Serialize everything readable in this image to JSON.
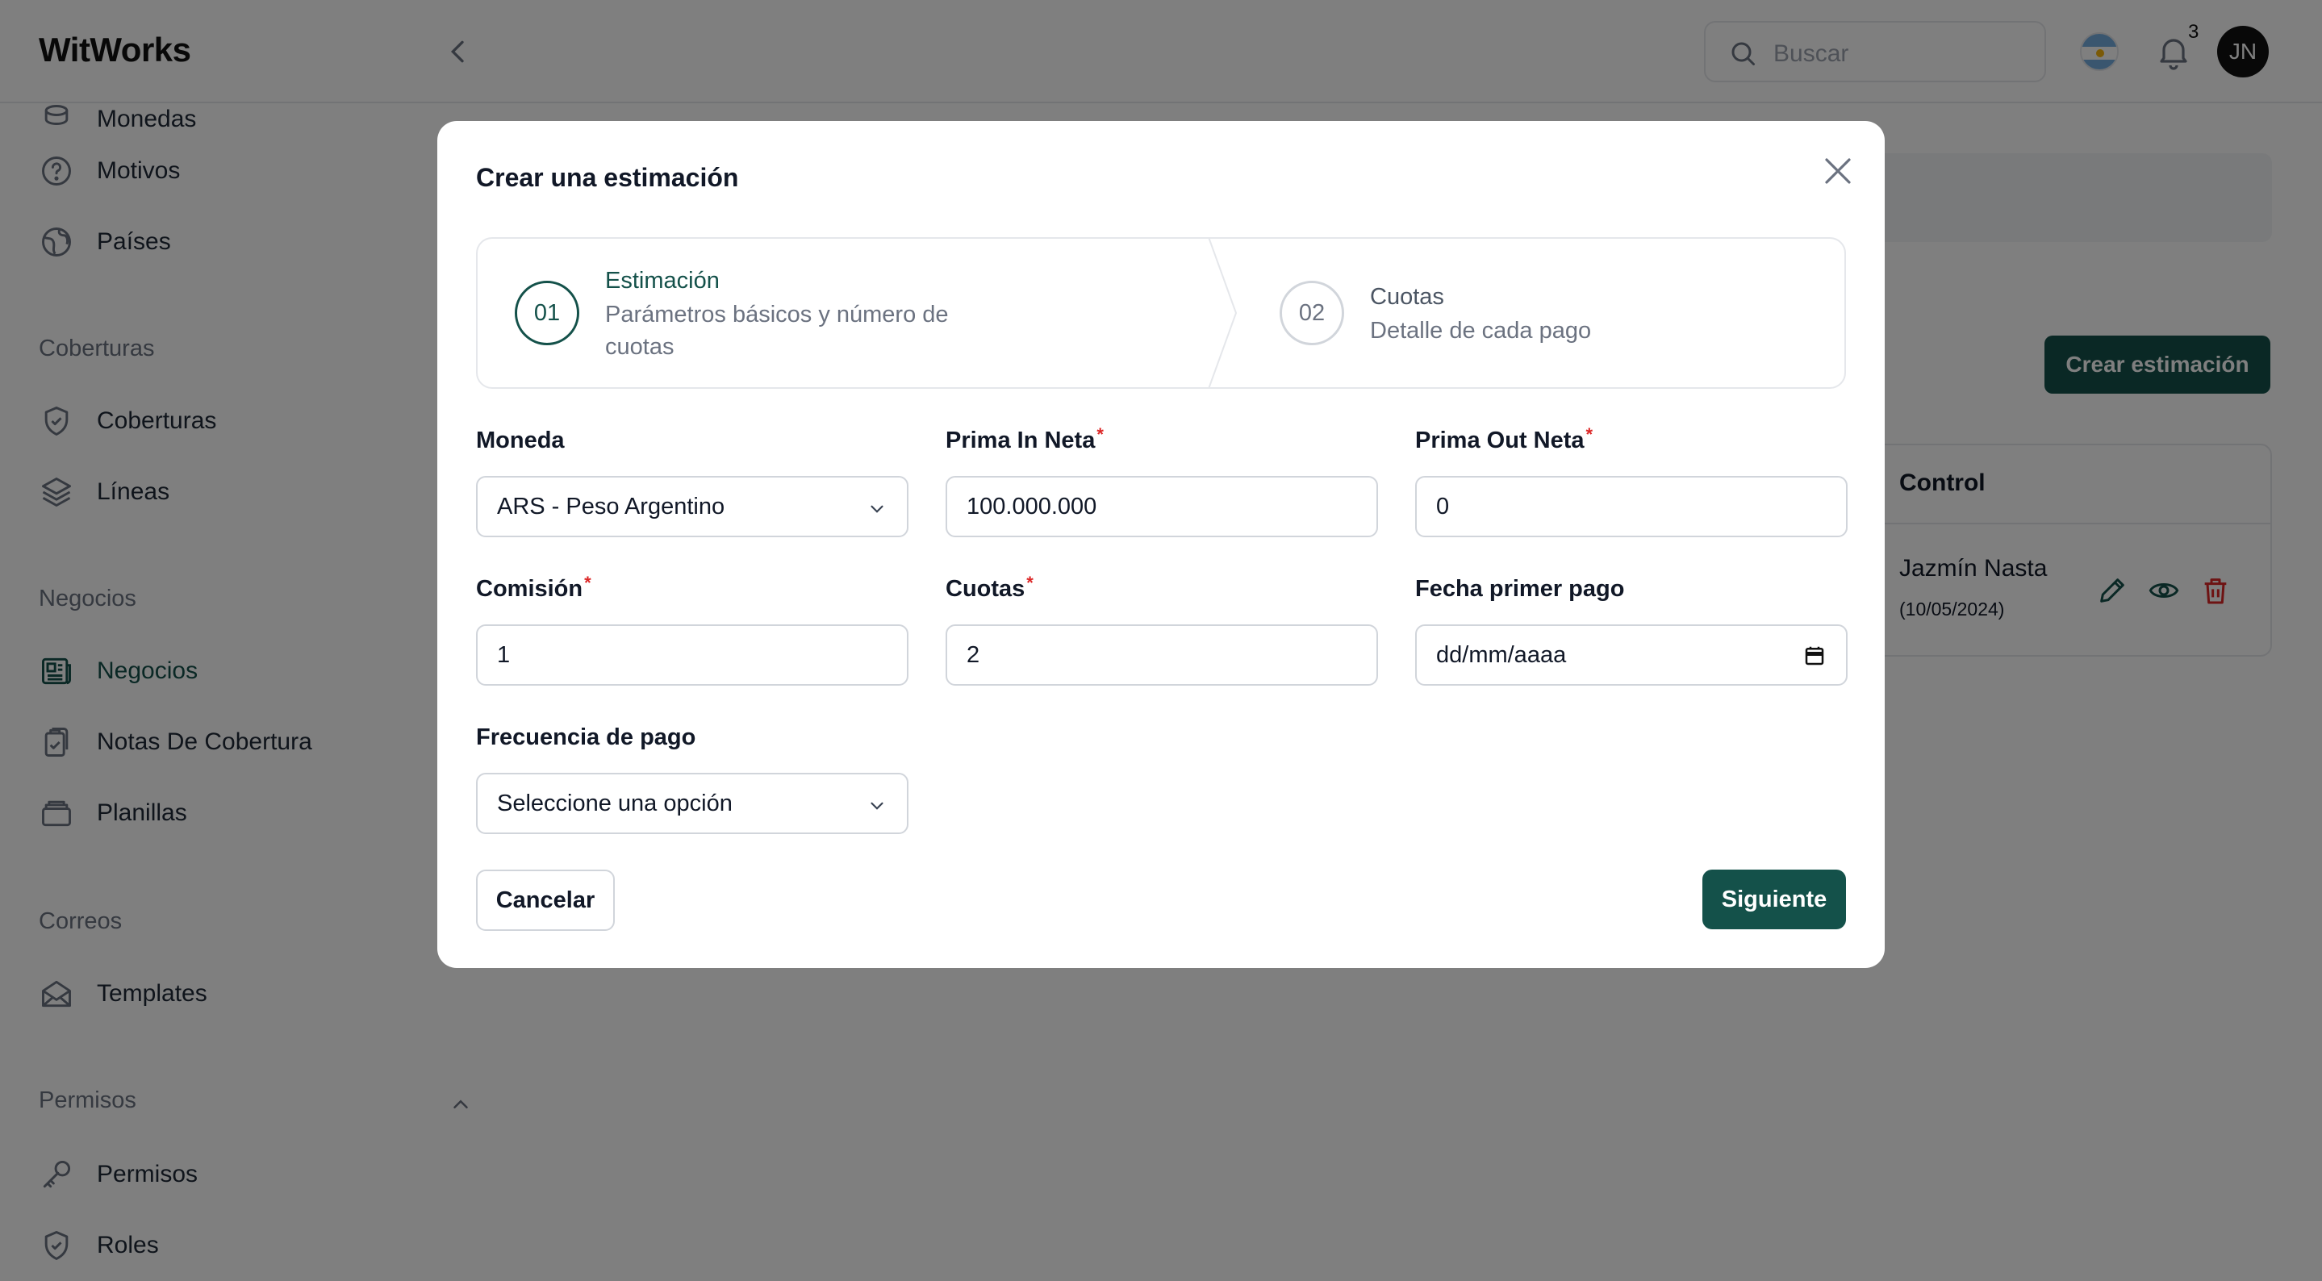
{
  "app": {
    "logo": "WitWorks"
  },
  "header": {
    "search_placeholder": "Buscar",
    "notification_count": "3",
    "user_initials": "JN"
  },
  "sidebar": {
    "items_top": [
      {
        "label": "Monedas",
        "icon": "coins-icon"
      },
      {
        "label": "Motivos",
        "icon": "question-circle-icon"
      },
      {
        "label": "Países",
        "icon": "globe-icon"
      }
    ],
    "section_coberturas": "Coberturas",
    "coberturas": [
      {
        "label": "Coberturas",
        "icon": "shield-icon"
      },
      {
        "label": "Líneas",
        "icon": "layers-icon"
      }
    ],
    "section_negocios": "Negocios",
    "negocios": [
      {
        "label": "Negocios",
        "icon": "newspaper-icon"
      },
      {
        "label": "Notas De Cobertura",
        "icon": "clipboard-icon"
      },
      {
        "label": "Planillas",
        "icon": "folder-icon"
      }
    ],
    "section_correos": "Correos",
    "correos": [
      {
        "label": "Templates",
        "icon": "mail-icon"
      }
    ],
    "section_permisos": "Permisos",
    "permisos": [
      {
        "label": "Permisos",
        "icon": "key-icon"
      },
      {
        "label": "Roles",
        "icon": "shield-icon"
      }
    ]
  },
  "main": {
    "crear_button": "Crear estimación",
    "table": {
      "header": "Control",
      "row": {
        "name": "Jazmín Nasta",
        "date": "(10/05/2024)"
      }
    }
  },
  "modal": {
    "title": "Crear una estimación",
    "steps": [
      {
        "number": "01",
        "title": "Estimación",
        "subtitle_line1": "Parámetros básicos y número de",
        "subtitle_line2": "cuotas",
        "state": "active"
      },
      {
        "number": "02",
        "title": "Cuotas",
        "subtitle_line1": "Detalle de cada pago",
        "state": "inactive"
      }
    ],
    "fields": {
      "moneda": {
        "label": "Moneda",
        "value": "ARS - Peso Argentino"
      },
      "prima_in": {
        "label": "Prima In Neta",
        "value": "100.000.000",
        "required": "*"
      },
      "prima_out": {
        "label": "Prima Out Neta",
        "value": "0",
        "required": "*"
      },
      "comision": {
        "label": "Comisión",
        "value": "1",
        "required": "*"
      },
      "cuotas": {
        "label": "Cuotas",
        "value": "2",
        "required": "*"
      },
      "fecha": {
        "label": "Fecha primer pago",
        "placeholder": "dd/mm/aaaa"
      },
      "frecuencia": {
        "label": "Frecuencia de pago",
        "value": "Seleccione una opción"
      }
    },
    "cancel_label": "Cancelar",
    "next_label": "Siguiente"
  },
  "colors": {
    "brand": "#14514a",
    "required": "#dc2626",
    "overlay": "rgba(0,0,0,0.5)"
  }
}
